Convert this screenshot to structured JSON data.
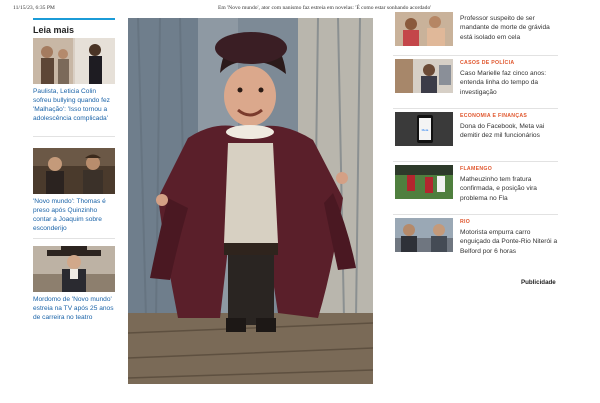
{
  "header": {
    "datetime": "11/15/23, 6:35 PM",
    "page_title": "Em 'Novo mundo', ator com nanismo faz estreia em novelas: 'É como estar sonhando acordado'"
  },
  "sidebar": {
    "heading": "Leia mais",
    "items": [
      {
        "caption": "Paulista, Leticia Colin sofreu bullying quando fez 'Malhação': 'Isso tornou a adolescência complicada'"
      },
      {
        "caption": "'Novo mundo': Thomas é preso após Quinzinho contar a Joaquim sobre esconderijo"
      },
      {
        "caption": "Mordomo de 'Novo mundo' estreia na TV após 25 anos de carreira no teatro"
      }
    ]
  },
  "related": [
    {
      "category": "",
      "title": "Professor suspeito de ser mandante de morte de grávida está isolado em cela"
    },
    {
      "category": "Casos de polícia",
      "title": "Caso Marielle faz cinco anos: entenda linha do tempo da investigação"
    },
    {
      "category": "Economia e Finanças",
      "title": "Dona do Facebook, Meta vai demitir dez mil funcionários"
    },
    {
      "category": "Flamengo",
      "title": "Matheuzinho tem fratura confirmada, e posição vira problema no Fla"
    },
    {
      "category": "Rio",
      "title": "Motorista empurra carro enguiçado da Ponte-Rio Niterói a Belford por 6 horas"
    }
  ],
  "publicidade": "Publicidade",
  "colors": {
    "accent_blue": "#1b9bd7",
    "link_blue": "#1a63a8",
    "category_orange": "#e0562d"
  }
}
